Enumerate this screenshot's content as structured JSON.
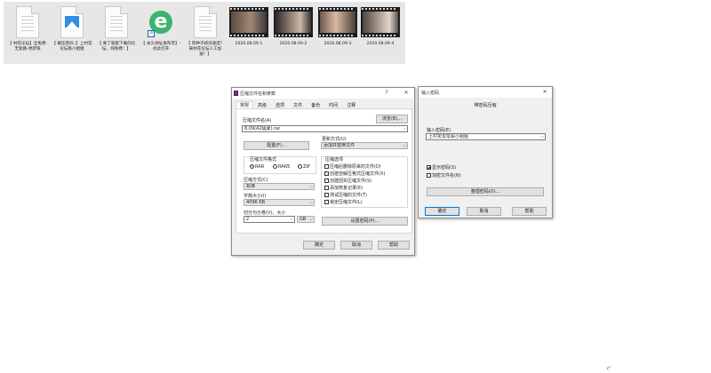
{
  "desktop": {
    "files": [
      {
        "kind": "doc",
        "label": "【 村花论坛】全免费-无套路-更新快"
      },
      {
        "kind": "image",
        "label": "【 解压密码：】上村花论坛看小姐姐"
      },
      {
        "kind": "doc",
        "label": "【 来了就能下载的论坛，纯免费！】"
      },
      {
        "kind": "ie-shortcut",
        "label": "【 永久地址发布页】-点此打开"
      },
      {
        "kind": "doc",
        "label": "【 有种子却没速度？来村花论坛人工加速！】"
      },
      {
        "kind": "video",
        "label": "2020.08.09-1"
      },
      {
        "kind": "video",
        "label": "2020.08.09-2"
      },
      {
        "kind": "video",
        "label": "2020.08.09-3"
      },
      {
        "kind": "video",
        "label": "2020.08.09-4"
      }
    ]
  },
  "archive_dialog": {
    "title": "压缩文件名和参数",
    "help_glyph": "?",
    "close_glyph": "✕",
    "tabs": [
      "常规",
      "高级",
      "选项",
      "文件",
      "备份",
      "时间",
      "注释"
    ],
    "archive_name_label": "压缩文件名(A)",
    "archive_name_value": "8.09(A2猛夏).rar",
    "browse_button": "浏览(B)...",
    "profiles_button": "配置(F)...",
    "update_mode_label": "更新方式(U)",
    "update_mode_value": "添加并替换文件",
    "format_label": "压缩文件格式",
    "formats": [
      {
        "label": "RAR",
        "selected": true
      },
      {
        "label": "RAR5",
        "selected": false
      },
      {
        "label": "ZIP",
        "selected": false
      }
    ],
    "method_label": "压缩方式(C)",
    "method_value": "标准",
    "dict_label": "字典大小(I)",
    "dict_value": "4096 KB",
    "split_label": "切分为分卷(V)，大小",
    "split_value": "2",
    "split_unit": "GB",
    "options_label": "压缩选项",
    "options": [
      {
        "label": "压缩后删除原来的文件(D)",
        "checked": false
      },
      {
        "label": "创建自解压格式压缩文件(X)",
        "checked": false
      },
      {
        "label": "创建固实压缩文件(S)",
        "checked": false
      },
      {
        "label": "添加恢复记录(E)",
        "checked": false
      },
      {
        "label": "测试压缩的文件(T)",
        "checked": false
      },
      {
        "label": "锁定压缩文件(L)",
        "checked": false
      }
    ],
    "set_password_button": "设置密码(P)...",
    "ok": "确定",
    "cancel": "取消",
    "help": "帮助"
  },
  "password_dialog": {
    "title": "输入密码",
    "close_glyph": "✕",
    "heading": "带密码压缩",
    "password_label": "输入密码(E)",
    "password_value": "上村花论坛看小姐姐",
    "show_password_label": "显示密码(S)",
    "show_password_checked": true,
    "encrypt_names_label": "加密文件名(N)",
    "encrypt_names_checked": false,
    "organize_button": "整理密码(O)...",
    "ok": "确定",
    "cancel": "取消",
    "help": "帮助"
  },
  "colors": {
    "desktop_tile_bg": "#e7e7e7",
    "dialog_bg": "#f0f0f0",
    "accent_border": "#0078d7"
  }
}
